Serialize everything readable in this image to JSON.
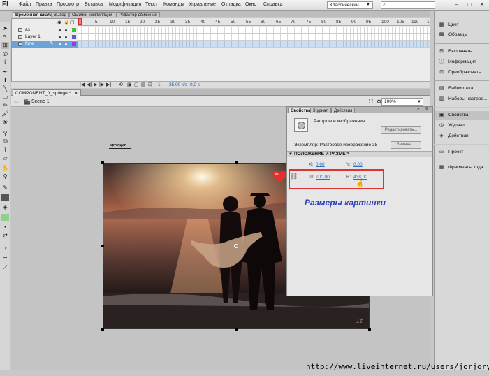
{
  "app_logo": "Fl",
  "menu": [
    "Файл",
    "Правка",
    "Просмотр",
    "Вставка",
    "Модификация",
    "Текст",
    "Команды",
    "Управление",
    "Отладка",
    "Окно",
    "Справка"
  ],
  "workspace": "Классический",
  "timeline_tabs": [
    "Временная шкала",
    "Вывод",
    "Ошибки компиляции",
    "Редактор движения"
  ],
  "frame_numbers": [
    "1",
    "5",
    "10",
    "15",
    "20",
    "25",
    "30",
    "35",
    "40",
    "45",
    "50",
    "55",
    "60",
    "65",
    "70",
    "75",
    "80",
    "85",
    "90",
    "95",
    "100",
    "105",
    "110",
    "1"
  ],
  "layers": [
    {
      "name": "as",
      "color": "#3ec23e"
    },
    {
      "name": "Layer 1",
      "color": "#5a5ad8"
    },
    {
      "name": "fone",
      "color": "#9a3ad8"
    }
  ],
  "timeline_footer": {
    "frame": "1",
    "fps": "25,00 к/с",
    "time": "0,0 s"
  },
  "document_tab": "COMPONENT_fr_springer*",
  "scene": "Scene 1",
  "zoom": "100%",
  "stage_label": "springer",
  "photo_signature": "J.T.",
  "properties": {
    "tabs": [
      "Свойства",
      "Журнал",
      "Действия"
    ],
    "type": "Растровое изображение",
    "edit_button": "Редактировать...",
    "instance": "Экземпляр: Растровое изображение 38",
    "swap_button": "Замена...",
    "section": "ПОЛОЖЕНИЕ И РАЗМЕР",
    "x_label": "X:",
    "x_value": "0,00",
    "y_label": "Y:",
    "y_value": "0,00",
    "w_label": "Ш:",
    "w_value": "700,00",
    "h_label": "В:",
    "h_value": "438,00"
  },
  "annotation": "Размеры картинки",
  "right_panels": [
    {
      "items": [
        {
          "icon": "color-icon",
          "label": "Цвет"
        },
        {
          "icon": "swatches-icon",
          "label": "Образцы"
        }
      ]
    },
    {
      "items": [
        {
          "icon": "align-icon",
          "label": "Выровнять"
        },
        {
          "icon": "info-icon",
          "label": "Информация"
        },
        {
          "icon": "transform-icon",
          "label": "Преобразовать"
        }
      ]
    },
    {
      "items": [
        {
          "icon": "library-icon",
          "label": "Библиотека"
        },
        {
          "icon": "presets-icon",
          "label": "Наборы настрое..."
        }
      ]
    },
    {
      "items": [
        {
          "icon": "properties-icon",
          "label": "Свойства"
        },
        {
          "icon": "history-icon",
          "label": "Журнал"
        },
        {
          "icon": "actions-icon",
          "label": "Действия"
        }
      ]
    },
    {
      "items": [
        {
          "icon": "project-icon",
          "label": "Проект"
        },
        {
          "icon": "code-snippets-icon",
          "label": "Фрагменты кода"
        }
      ]
    }
  ],
  "url": "http://www.liveinternet.ru/users/jorjorych/"
}
